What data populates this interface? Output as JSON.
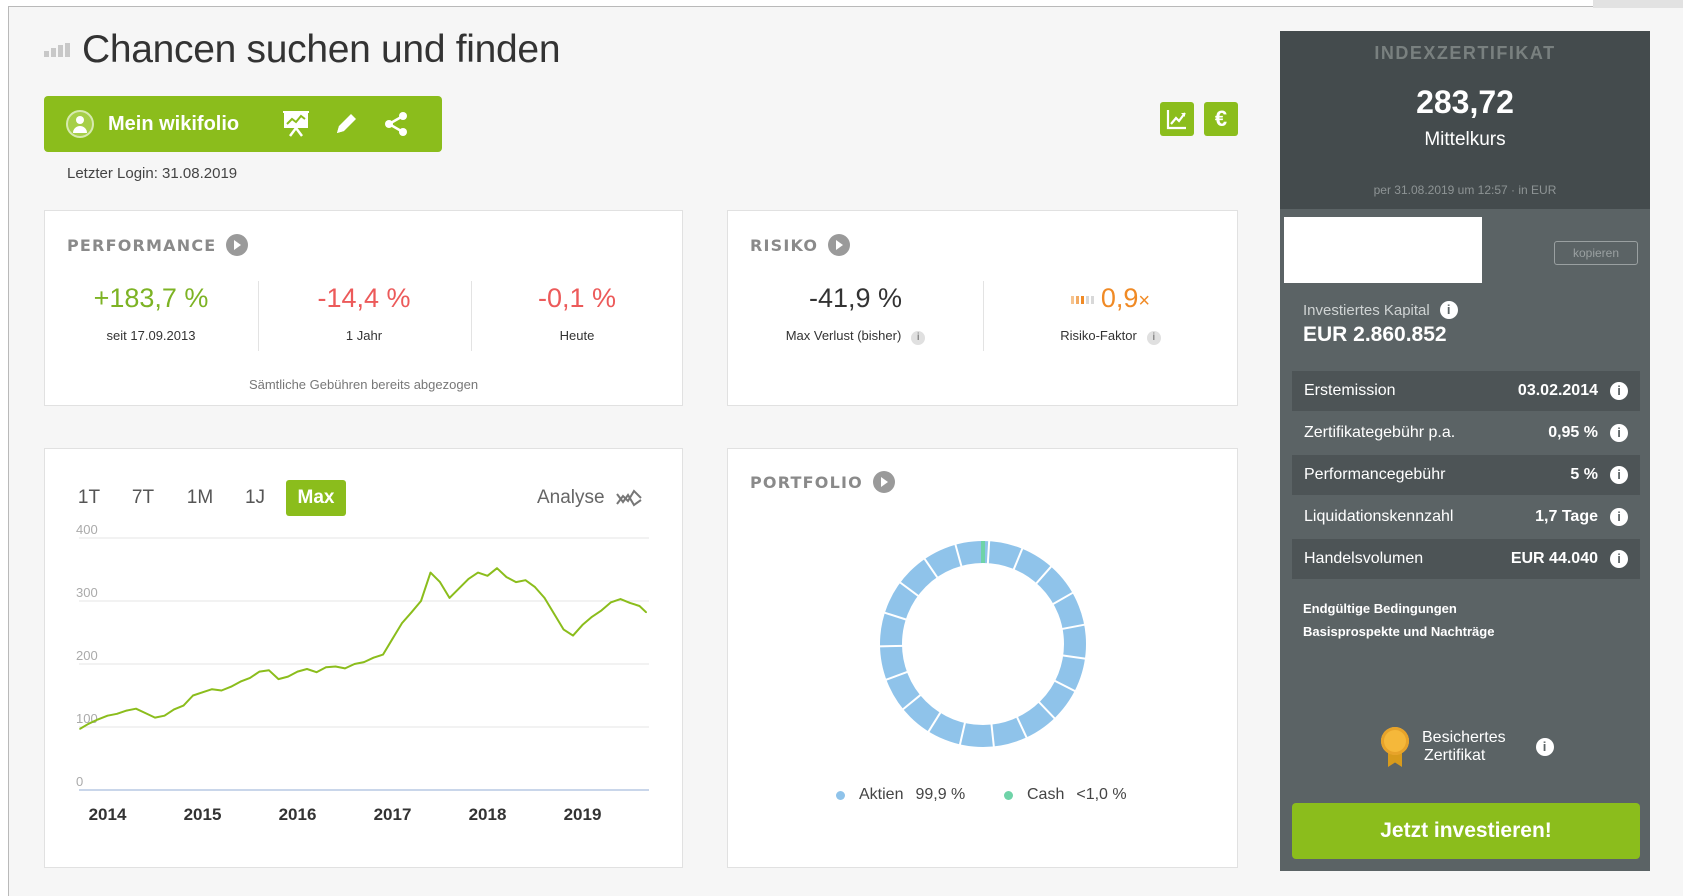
{
  "page": {
    "title": "Chancen suchen und finden",
    "last_login": "Letzter Login: 31.08.2019"
  },
  "toolbar": {
    "mein_wikifolio": "Mein wikifolio",
    "chart_button_symbol": "↗",
    "euro_button_symbol": "€"
  },
  "performance": {
    "title": "PERFORMANCE",
    "stats": [
      {
        "value": "+183,7 %",
        "label": "seit 17.09.2013"
      },
      {
        "value": "-14,4 %",
        "label": "1 Jahr"
      },
      {
        "value": "-0,1 %",
        "label": "Heute"
      }
    ],
    "fee_note": "Sämtliche Gebühren bereits abgezogen"
  },
  "risiko": {
    "title": "RISIKO",
    "max_loss_value": "-41,9 %",
    "max_loss_label": "Max Verlust (bisher)",
    "factor_value": "0,9",
    "factor_suffix": "×",
    "factor_label": "Risiko-Faktor",
    "info_symbol": "i"
  },
  "chart": {
    "ranges": [
      "1T",
      "7T",
      "1M",
      "1J",
      "Max"
    ],
    "active_range": "Max",
    "analyse_label": "Analyse"
  },
  "chart_data": {
    "type": "line",
    "x_tick_labels": [
      "2014",
      "2015",
      "2016",
      "2017",
      "2018",
      "2019"
    ],
    "y_tick_labels": [
      "0",
      "100",
      "200",
      "300",
      "400"
    ],
    "ylim": [
      0,
      400
    ],
    "xlim": [
      2013.7,
      2019.7
    ],
    "line_color": "#8bbd1c",
    "series": [
      {
        "x": [
          2013.71,
          2013.8,
          2013.9,
          2014.0,
          2014.1,
          2014.2,
          2014.3,
          2014.4,
          2014.5,
          2014.6,
          2014.7,
          2014.8,
          2014.9,
          2015.0,
          2015.1,
          2015.2,
          2015.3,
          2015.4,
          2015.5,
          2015.6,
          2015.7,
          2015.8,
          2015.9,
          2016.0,
          2016.1,
          2016.2,
          2016.3,
          2016.4,
          2016.5,
          2016.6,
          2016.7,
          2016.8,
          2016.9,
          2017.0,
          2017.1,
          2017.2,
          2017.3,
          2017.4,
          2017.5,
          2017.6,
          2017.7,
          2017.8,
          2017.9,
          2018.0,
          2018.1,
          2018.2,
          2018.3,
          2018.4,
          2018.5,
          2018.6,
          2018.7,
          2018.8,
          2018.9,
          2019.0,
          2019.1,
          2019.2,
          2019.3,
          2019.4,
          2019.5,
          2019.6,
          2019.67
        ],
        "y": [
          97,
          105,
          112,
          118,
          121,
          126,
          129,
          122,
          115,
          118,
          128,
          134,
          150,
          155,
          160,
          158,
          164,
          172,
          178,
          188,
          190,
          176,
          180,
          188,
          192,
          187,
          195,
          196,
          193,
          200,
          203,
          210,
          215,
          240,
          265,
          282,
          300,
          345,
          330,
          305,
          320,
          335,
          345,
          340,
          352,
          338,
          330,
          333,
          322,
          305,
          280,
          255,
          245,
          262,
          275,
          285,
          298,
          303,
          297,
          292,
          282
        ]
      }
    ]
  },
  "portfolio": {
    "title": "PORTFOLIO",
    "legend": [
      {
        "label": "Aktien",
        "value": "99,9 %",
        "color": "#8fc3ea"
      },
      {
        "label": "Cash",
        "value": "<1,0 %",
        "color": "#6fd3a8"
      }
    ],
    "aktien_share": 0.999,
    "cash_share": 0.001
  },
  "side": {
    "cert_label": "INDEXZERTIFIKAT",
    "price": "283,72",
    "price_label": "Mittelkurs",
    "date_note": "per 31.08.2019 um 12:57 · in EUR",
    "kopieren": "kopieren",
    "invested_label": "Investiertes Kapital",
    "invested_value": "EUR 2.860.852",
    "rows": [
      {
        "key": "Erstemission",
        "value": "03.02.2014"
      },
      {
        "key": "Zertifikategebühr p.a.",
        "value": "0,95 %"
      },
      {
        "key": "Performancegebühr",
        "value": "5 %"
      },
      {
        "key": "Liquidationskennzahl",
        "value": "1,7 Tage"
      },
      {
        "key": "Handelsvolumen",
        "value": "EUR 44.040"
      }
    ],
    "link1": "Endgültige Bedingungen",
    "link2": "Basisprospekte und Nachträge",
    "secured_line1": "Besichertes",
    "secured_line2": "Zertifikat",
    "invest_button": "Jetzt investieren!",
    "info_symbol": "i"
  }
}
